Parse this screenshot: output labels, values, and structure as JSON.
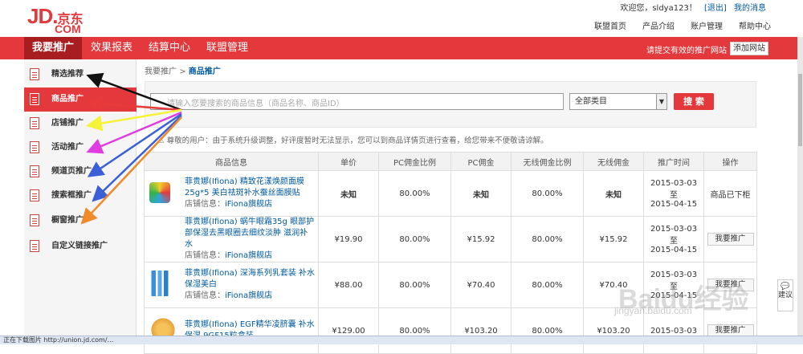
{
  "header": {
    "logo_main": "JD.",
    "logo_cn": "京东",
    "logo_sub": "COM",
    "welcome": "欢迎您，sldya123！",
    "logout": "[退出]",
    "messages": "我的消息",
    "links": [
      "联盟首页",
      "产品介绍",
      "账户管理",
      "帮助中心"
    ]
  },
  "nav": {
    "items": [
      "我要推广",
      "效果报表",
      "结算中心",
      "联盟管理"
    ],
    "note": "请提交有效的推广网站",
    "add_site": "添加网站"
  },
  "sidebar": {
    "items": [
      "精选推荐",
      "商品推广",
      "店铺推广",
      "活动推广",
      "频道页推广",
      "搜索框推广",
      "橱窗推广",
      "自定义链接推广"
    ],
    "active": "商品推广"
  },
  "breadcrumb": {
    "root": "我要推广",
    "sep": ">",
    "current": "商品推广"
  },
  "search": {
    "placeholder": "请输入您要搜索的商品信息（商品名称、商品ID）",
    "category": "全部类目",
    "button": "搜 索"
  },
  "notice": "尊敬的用户：由于系统升级调整，好评度暂时无法显示，您可以到商品详情页进行查看，给您带来不便敬请谅解。",
  "table": {
    "headers": [
      "商品信息",
      "单价",
      "PC佣金比例",
      "PC佣金",
      "无线佣金比例",
      "无线佣金",
      "推广时间",
      "操作"
    ],
    "rows": [
      {
        "name": "菲贵娜(Ifiona) 精致花漾焕颜面膜25g*5 美白祛斑补水蚕丝面膜贴",
        "store_label": "店铺信息：",
        "store": "iFiona旗舰店",
        "price": "未知",
        "pc_rate": "80.00%",
        "pc_comm": "未知",
        "wl_rate": "80.00%",
        "wl_comm": "未知",
        "date_from": "2015-03-03",
        "date_to_label": "至",
        "date_to": "2015-04-15",
        "op": "商品已下柜"
      },
      {
        "name": "菲贵娜(Ifiona) 蜗牛眼霜35g 眼部护部保湿去黑眼圈去细纹淡肿 滋润补水",
        "store_label": "店铺信息：",
        "store": "iFiona旗舰店",
        "price": "¥19.90",
        "pc_rate": "80.00%",
        "pc_comm": "¥15.92",
        "wl_rate": "80.00%",
        "wl_comm": "¥15.92",
        "date_from": "2015-03-03",
        "date_to_label": "至",
        "date_to": "2015-04-15",
        "op": "我要推广"
      },
      {
        "name": "菲贵娜(Ifiona) 深海系列乳套装 补水保湿美白",
        "store_label": "店铺信息：",
        "store": "iFiona旗舰店",
        "price": "¥88.00",
        "pc_rate": "80.00%",
        "pc_comm": "¥70.40",
        "wl_rate": "80.00%",
        "wl_comm": "¥70.40",
        "date_from": "2015-03-03",
        "date_to_label": "至",
        "date_to": "2015-04-15",
        "op": "我要推广"
      },
      {
        "name": "菲贵娜(Ifiona) EGF精华凌脐囊 补水保湿 9GF15粒盒装",
        "store_label": "",
        "store": "",
        "price": "¥129.00",
        "pc_rate": "80.00%",
        "pc_comm": "¥103.20",
        "wl_rate": "80.00%",
        "wl_comm": "¥103.20",
        "date_from": "2015-03-03",
        "date_to_label": "",
        "date_to": "",
        "op": "我要推广"
      }
    ]
  },
  "feedback": "建议",
  "watermark": "Baidu经验",
  "watermark_sub": "jingyan.baidu.com",
  "status_bar": "正在下载图片 http://union.jd.com/...",
  "colors": {
    "brand_red": "#e4393c",
    "link_blue": "#005aa0",
    "nav_active": "#a81d20"
  }
}
